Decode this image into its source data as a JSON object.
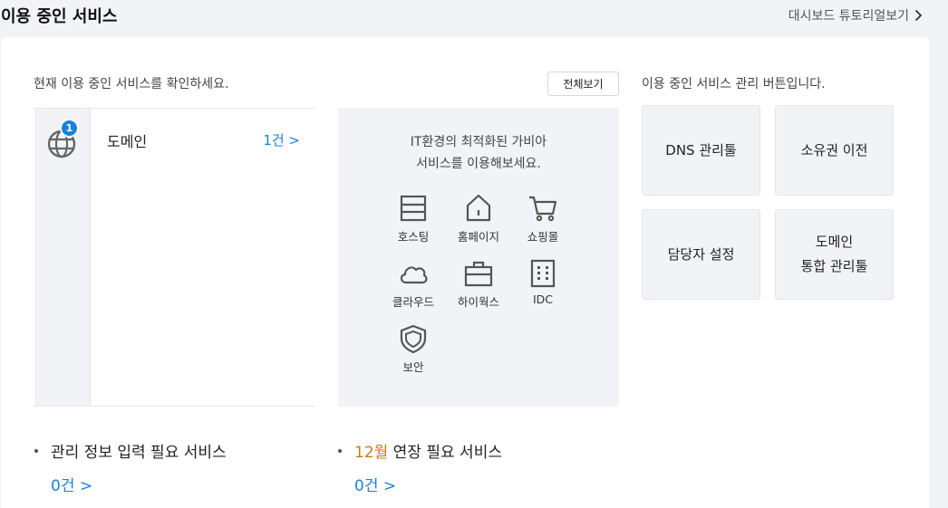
{
  "header": {
    "title": "이용 중인 서비스",
    "tutorial_link": "대시보드 튜토리얼보기"
  },
  "intro": {
    "text": "현재 이용 중인 서비스를 확인하세요.",
    "view_all": "전체보기",
    "mgmt_desc": "이용 중인 서비스 관리 버튼입니다."
  },
  "services": {
    "domain": {
      "label": "도메인",
      "count": "1건 >",
      "badge": "1",
      "icon": "globe-icon"
    }
  },
  "promo": {
    "line1": "IT환경의 최적화된 가비아",
    "line2": "서비스를 이용해보세요.",
    "items": [
      {
        "label": "호스팅",
        "icon": "server-icon"
      },
      {
        "label": "홈페이지",
        "icon": "house-icon"
      },
      {
        "label": "쇼핑몰",
        "icon": "cart-icon"
      },
      {
        "label": "클라우드",
        "icon": "cloud-icon"
      },
      {
        "label": "하이웍스",
        "icon": "briefcase-icon"
      },
      {
        "label": "IDC",
        "icon": "building-icon"
      },
      {
        "label": "보안",
        "icon": "shield-icon"
      }
    ]
  },
  "management": {
    "dns": "DNS 관리툴",
    "ownership": "소유권 이전",
    "contact": "담당자 설정",
    "integrated": "도메인\n통합 관리툴"
  },
  "bottom": {
    "info_required": {
      "title": "관리 정보 입력 필요 서비스",
      "count": "0건 >"
    },
    "renewal": {
      "month": "12월",
      "title": " 연장 필요 서비스",
      "count": "0건 >"
    }
  },
  "colors": {
    "accent": "#1a82dc",
    "highlight": "#c77b1a",
    "panel_bg": "#f2f3f7"
  }
}
